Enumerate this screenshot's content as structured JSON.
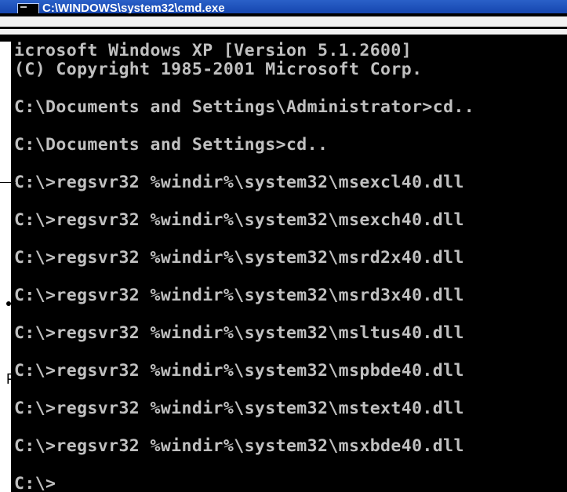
{
  "window": {
    "title": "C:\\WINDOWS\\system32\\cmd.exe",
    "icon": "cmd-console-icon"
  },
  "console": {
    "lines": [
      "icrosoft Windows XP [Version 5.1.2600]",
      "(C) Copyright 1985-2001 Microsoft Corp.",
      "",
      "C:\\Documents and Settings\\Administrator>cd..",
      "",
      "C:\\Documents and Settings>cd..",
      "",
      "C:\\>regsvr32 %windir%\\system32\\msexcl40.dll",
      "",
      "C:\\>regsvr32 %windir%\\system32\\msexch40.dll",
      "",
      "C:\\>regsvr32 %windir%\\system32\\msrd2x40.dll",
      "",
      "C:\\>regsvr32 %windir%\\system32\\msrd3x40.dll",
      "",
      "C:\\>regsvr32 %windir%\\system32\\msltus40.dll",
      "",
      "C:\\>regsvr32 %windir%\\system32\\mspbde40.dll",
      "",
      "C:\\>regsvr32 %windir%\\system32\\mstext40.dll",
      "",
      "C:\\>regsvr32 %windir%\\system32\\msxbde40.dll",
      "",
      "C:\\>"
    ]
  },
  "annotation": {
    "letter": "F"
  },
  "colors": {
    "console_bg": "#000000",
    "console_text": "#c0c0c0",
    "titlebar": "#0f3ea8"
  }
}
